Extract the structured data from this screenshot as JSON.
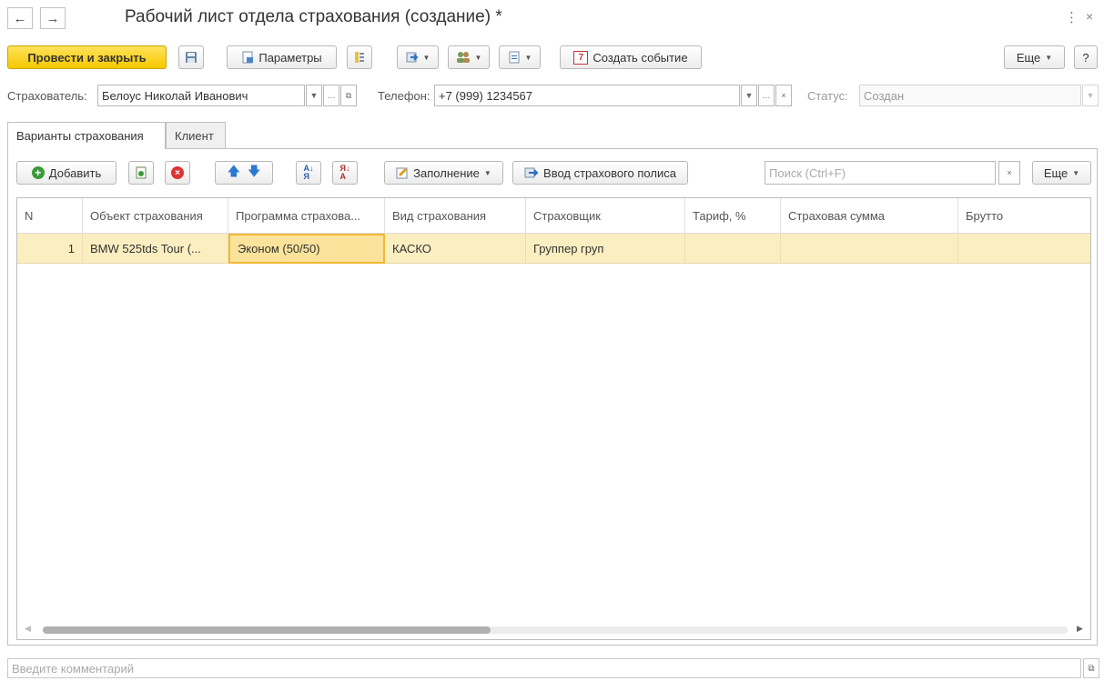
{
  "window": {
    "title": "Рабочий лист отдела страхования (создание) *",
    "more_icon": "more-vert-icon",
    "close_icon": "close-icon"
  },
  "toolbar": {
    "post_close_label": "Провести и закрыть",
    "params_label": "Параметры",
    "create_event_label": "Создать событие",
    "create_event_day": "7",
    "more_label": "Еще",
    "help_label": "?"
  },
  "fields": {
    "insurer_label": "Страхователь:",
    "insurer_value": "Белоус Николай Иванович",
    "phone_label": "Телефон:",
    "phone_value": "+7 (999) 1234567",
    "status_label": "Статус:",
    "status_value": "Создан"
  },
  "tabs": [
    {
      "label": "Варианты страхования",
      "active": true
    },
    {
      "label": "Клиент",
      "active": false
    }
  ],
  "table_toolbar": {
    "add_label": "Добавить",
    "fill_label": "Заполнение",
    "policy_label": "Ввод страхового полиса",
    "search_placeholder": "Поиск (Ctrl+F)",
    "more_label": "Еще"
  },
  "table": {
    "columns": [
      "N",
      "Объект страхования",
      "Программа страхова...",
      "Вид страхования",
      "Страховщик",
      "Тариф, %",
      "Страховая сумма",
      "Брутто"
    ],
    "rows": [
      [
        "1",
        "BMW 525tds Tour (...",
        "Эконом  (50/50)",
        "КАСКО",
        "Группер груп",
        "",
        "",
        ""
      ]
    ]
  },
  "comment": {
    "placeholder": "Введите комментарий"
  },
  "colors": {
    "primary_button": "#f6c800",
    "selected_row": "#fbeec0",
    "selected_cell_border": "#f0b835"
  }
}
